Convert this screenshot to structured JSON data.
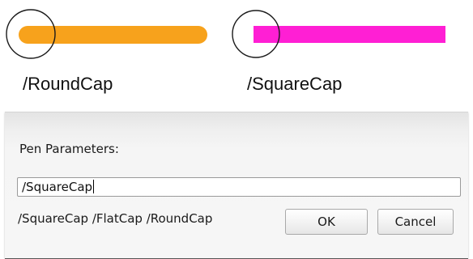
{
  "caps": {
    "round": {
      "label": "/RoundCap",
      "color": "#f7a21c"
    },
    "square": {
      "label": "/SquareCap",
      "color": "#ff1fd4"
    }
  },
  "dialog": {
    "title": "Pen Parameters:",
    "input_value": "/SquareCap",
    "options_text": "/SquareCap /FlatCap /RoundCap",
    "ok_label": "OK",
    "cancel_label": "Cancel"
  }
}
